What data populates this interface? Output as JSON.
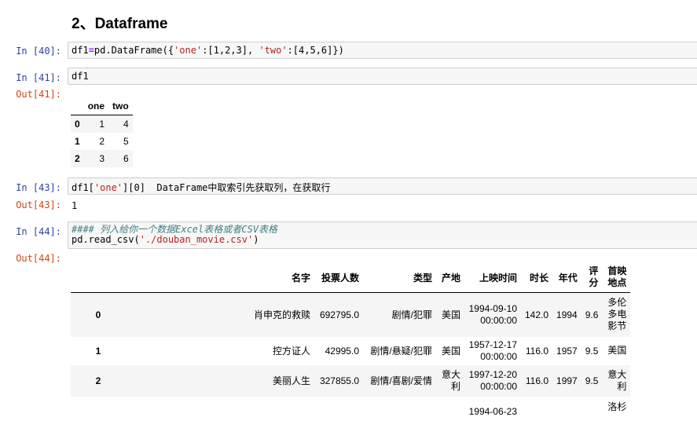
{
  "heading": "2、Dataframe",
  "cells": {
    "c40": {
      "in": "In  [40]:",
      "code_parts": [
        "df1",
        "=",
        "pd.DataFrame({",
        "'one'",
        ":[1,2,3], ",
        "'two'",
        ":[4,5,6]})"
      ]
    },
    "c41": {
      "in": "In  [41]:",
      "code": "df1",
      "out": "Out[41]:"
    },
    "c43": {
      "in": "In  [43]:",
      "code_parts": [
        "df1[",
        "'one'",
        "][0]  DataFrame中取索引先获取列，在获取行"
      ],
      "out": "Out[43]:",
      "result": "1"
    },
    "c44": {
      "in": "In  [44]:",
      "comment": "#### 列入给你一个数据Excel表格或者CSV表格",
      "code_parts": [
        "pd.read_csv(",
        "'./douban_movie.csv'",
        ")"
      ],
      "out": "Out[44]:"
    }
  },
  "df1": {
    "columns": [
      "one",
      "two"
    ],
    "rows": [
      {
        "index": "0",
        "values": [
          "1",
          "4"
        ]
      },
      {
        "index": "1",
        "values": [
          "2",
          "5"
        ]
      },
      {
        "index": "2",
        "values": [
          "3",
          "6"
        ]
      }
    ]
  },
  "movies": {
    "columns": [
      "名字",
      "投票人数",
      "类型",
      "产地",
      "上映时间",
      "时长",
      "年代",
      "评分",
      "首映地点"
    ],
    "rows": [
      {
        "index": "0",
        "values": [
          "肖申克的救赎",
          "692795.0",
          "剧情/犯罪",
          "美国",
          "1994-09-10 00:00:00",
          "142.0",
          "1994",
          "9.6",
          "多伦多电影节"
        ]
      },
      {
        "index": "1",
        "values": [
          "控方证人",
          "42995.0",
          "剧情/悬疑/犯罪",
          "美国",
          "1957-12-17 00:00:00",
          "116.0",
          "1957",
          "9.5",
          "美国"
        ]
      },
      {
        "index": "2",
        "values": [
          "美丽人生",
          "327855.0",
          "剧情/喜剧/爱情",
          "意大利",
          "1997-12-20 00:00:00",
          "116.0",
          "1997",
          "9.5",
          "意大利"
        ]
      },
      {
        "index": "",
        "values": [
          "",
          "",
          "",
          "",
          "1994-06-23",
          "",
          "",
          "",
          "洛杉"
        ]
      }
    ]
  }
}
